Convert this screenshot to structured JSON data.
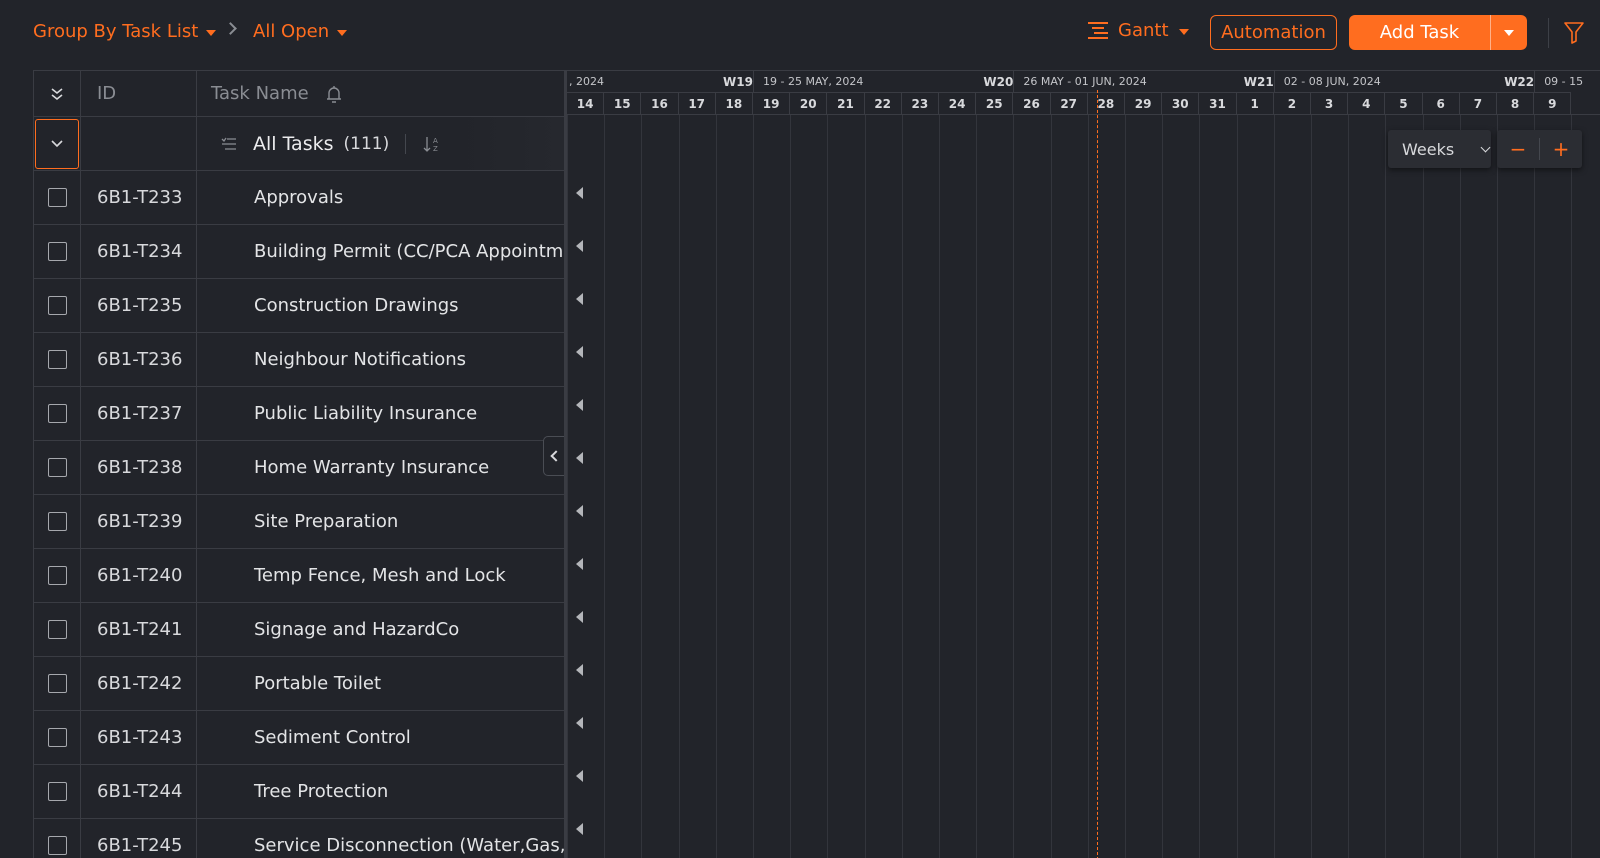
{
  "toolbar": {
    "group_by_label": "Group By Task List",
    "filter_label": "All Open",
    "view_label": "Gantt",
    "automation_label": "Automation",
    "add_task_label": "Add Task"
  },
  "table": {
    "col_id": "ID",
    "col_name": "Task Name",
    "group": {
      "title": "All Tasks",
      "count": "(111)"
    },
    "rows": [
      {
        "id": "6B1-T233",
        "name": "Approvals"
      },
      {
        "id": "6B1-T234",
        "name": "Building Permit (CC/PCA Appointm"
      },
      {
        "id": "6B1-T235",
        "name": "Construction Drawings"
      },
      {
        "id": "6B1-T236",
        "name": "Neighbour Notifications"
      },
      {
        "id": "6B1-T237",
        "name": "Public Liability Insurance"
      },
      {
        "id": "6B1-T238",
        "name": "Home Warranty Insurance"
      },
      {
        "id": "6B1-T239",
        "name": "Site Preparation"
      },
      {
        "id": "6B1-T240",
        "name": "Temp Fence, Mesh and Lock"
      },
      {
        "id": "6B1-T241",
        "name": "Signage and HazardCo"
      },
      {
        "id": "6B1-T242",
        "name": "Portable Toilet"
      },
      {
        "id": "6B1-T243",
        "name": "Sediment Control"
      },
      {
        "id": "6B1-T244",
        "name": "Tree Protection"
      },
      {
        "id": "6B1-T245",
        "name": "Service Disconnection (Water,Gas,E"
      }
    ]
  },
  "gantt": {
    "weeks": [
      {
        "label": ", 2024",
        "code": "W19"
      },
      {
        "label": "19 - 25 MAY, 2024",
        "code": "W20"
      },
      {
        "label": "26 MAY - 01 JUN, 2024",
        "code": "W21"
      },
      {
        "label": "02 - 08 JUN, 2024",
        "code": "W22"
      },
      {
        "label": "09 - 15",
        "code": ""
      }
    ],
    "days": [
      "14",
      "15",
      "16",
      "17",
      "18",
      "19",
      "20",
      "21",
      "22",
      "23",
      "24",
      "25",
      "26",
      "27",
      "28",
      "29",
      "30",
      "31",
      "1",
      "2",
      "3",
      "4",
      "5",
      "6",
      "7",
      "8",
      "9"
    ],
    "zoom_label": "Weeks",
    "zoom_out": "−",
    "zoom_in": "+"
  },
  "colors": {
    "accent": "#ff6d1f",
    "background": "#22242a"
  }
}
